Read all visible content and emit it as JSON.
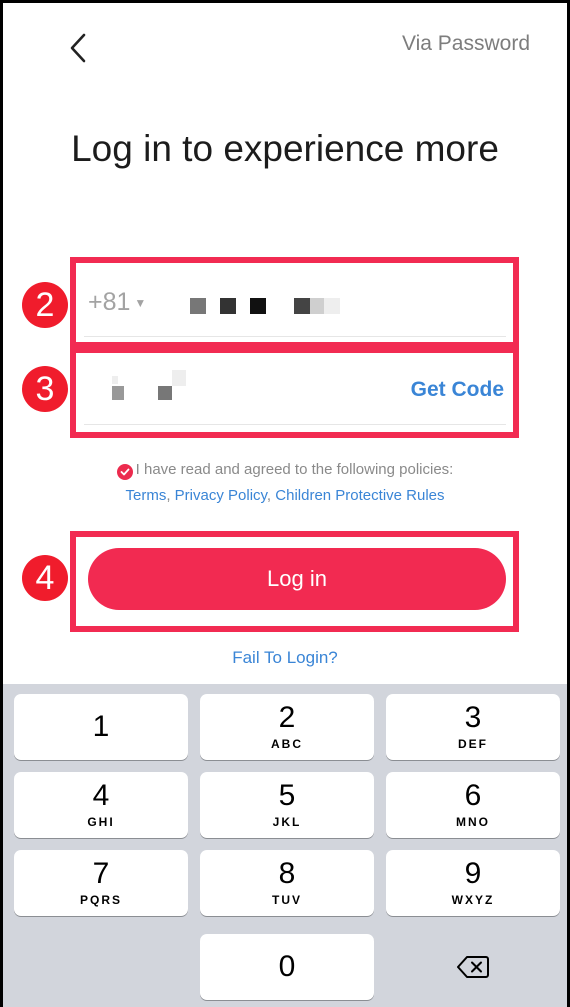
{
  "header": {
    "back_icon": "chevron-left-icon",
    "via_password": "Via Password"
  },
  "title": "Log in to experience more",
  "phone": {
    "country_code": "+81",
    "caret_icon": "caret-down-icon"
  },
  "code": {
    "get_code": "Get Code"
  },
  "policy": {
    "check_icon": "checkmark-circle-icon",
    "text": "I have read and agreed to the following policies:",
    "terms": "Terms",
    "sep1": ", ",
    "privacy": "Privacy Policy",
    "sep2": ", ",
    "children": "Children Protective Rules"
  },
  "login_button": "Log in",
  "fail_link": "Fail To Login?",
  "annotations": [
    "2",
    "3",
    "4"
  ],
  "keyboard": {
    "keys": [
      {
        "num": "1",
        "letters": ""
      },
      {
        "num": "2",
        "letters": "ABC"
      },
      {
        "num": "3",
        "letters": "DEF"
      },
      {
        "num": "4",
        "letters": "GHI"
      },
      {
        "num": "5",
        "letters": "JKL"
      },
      {
        "num": "6",
        "letters": "MNO"
      },
      {
        "num": "7",
        "letters": "PQRS"
      },
      {
        "num": "8",
        "letters": "TUV"
      },
      {
        "num": "9",
        "letters": "WXYZ"
      },
      {
        "num": "0",
        "letters": ""
      }
    ],
    "delete_icon": "backspace-icon"
  },
  "colors": {
    "accent": "#f22a51",
    "link": "#3a85d6",
    "highlight": "#f22b52",
    "badge": "#f01c2c"
  }
}
